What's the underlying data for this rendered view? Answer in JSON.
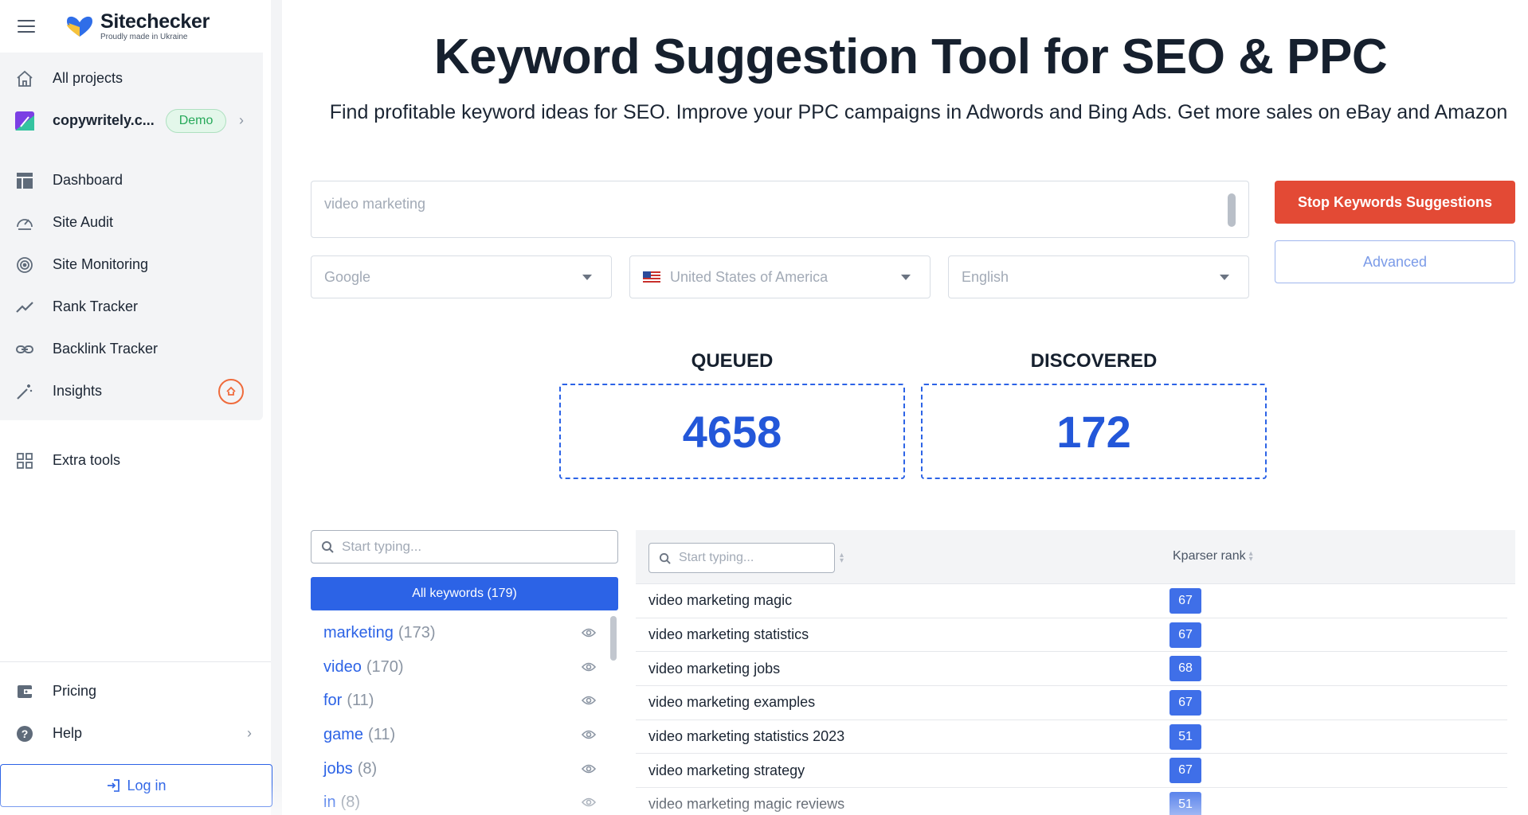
{
  "brand": {
    "name": "Sitechecker",
    "tagline": "Proudly made in Ukraine"
  },
  "sidebar": {
    "top_items": [
      {
        "label": "All projects",
        "icon": "home-icon"
      },
      {
        "label": "copywritely.c...",
        "icon": "project-logo-icon",
        "badge": "Demo"
      }
    ],
    "items": [
      {
        "label": "Dashboard",
        "icon": "dashboard-icon"
      },
      {
        "label": "Site Audit",
        "icon": "speedometer-icon"
      },
      {
        "label": "Site Monitoring",
        "icon": "monitoring-icon"
      },
      {
        "label": "Rank Tracker",
        "icon": "trend-line-icon"
      },
      {
        "label": "Backlink Tracker",
        "icon": "link-icon"
      },
      {
        "label": "Insights",
        "icon": "magic-wand-icon"
      }
    ],
    "extra": {
      "label": "Extra tools",
      "icon": "grid-icon"
    },
    "bottom": [
      {
        "label": "Pricing",
        "icon": "wallet-icon"
      },
      {
        "label": "Help",
        "icon": "question-icon"
      }
    ],
    "login_label": "Log in"
  },
  "page": {
    "title": "Keyword Suggestion Tool for SEO & PPC",
    "subtitle": "Find profitable keyword ideas for SEO. Improve your PPC campaigns in Adwords and Bing Ads. Get more sales on eBay and Amazon"
  },
  "form": {
    "keyword_value": "video marketing",
    "engine": "Google",
    "country": "United States of America",
    "language": "English",
    "stop_label": "Stop Keywords Suggestions",
    "advanced_label": "Advanced"
  },
  "stats": {
    "queued_label": "QUEUED",
    "queued_value": "4658",
    "discovered_label": "DISCOVERED",
    "discovered_value": "172"
  },
  "groups": {
    "search_placeholder": "Start typing...",
    "all_label": "All keywords (179)",
    "items": [
      {
        "word": "marketing",
        "count": "(173)"
      },
      {
        "word": "video",
        "count": "(170)"
      },
      {
        "word": "for",
        "count": "(11)"
      },
      {
        "word": "game",
        "count": "(11)"
      },
      {
        "word": "jobs",
        "count": "(8)"
      },
      {
        "word": "in",
        "count": "(8)"
      }
    ]
  },
  "table": {
    "search_placeholder": "Start typing...",
    "rank_header": "Kparser rank",
    "rows": [
      {
        "keyword": "video marketing magic",
        "rank": "67"
      },
      {
        "keyword": "video marketing statistics",
        "rank": "67"
      },
      {
        "keyword": "video marketing jobs",
        "rank": "68"
      },
      {
        "keyword": "video marketing examples",
        "rank": "67"
      },
      {
        "keyword": "video marketing statistics 2023",
        "rank": "51"
      },
      {
        "keyword": "video marketing strategy",
        "rank": "67"
      },
      {
        "keyword": "video marketing magic reviews",
        "rank": "51"
      }
    ]
  },
  "colors": {
    "accent": "#2c63e6",
    "stop": "#e34a35",
    "demo_green": "#27a95a",
    "insight_orange": "#ef6b3c"
  }
}
